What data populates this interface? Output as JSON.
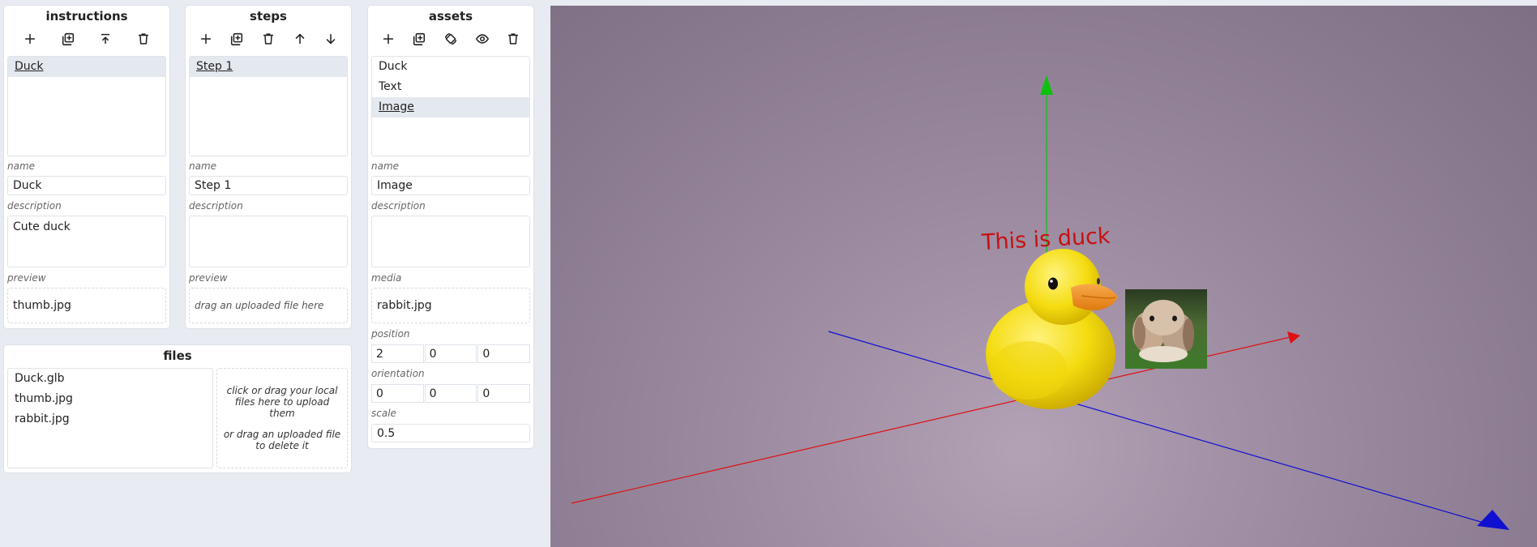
{
  "instructions": {
    "title": "instructions",
    "toolbar": [
      "add-icon",
      "duplicate-icon",
      "upload-icon",
      "delete-icon"
    ],
    "items": [
      {
        "label": "Duck",
        "selected": true
      }
    ],
    "name_label": "name",
    "name_value": "Duck",
    "description_label": "description",
    "description_value": "Cute duck",
    "preview_label": "preview",
    "preview_value": "thumb.jpg"
  },
  "steps": {
    "title": "steps",
    "toolbar": [
      "add-icon",
      "duplicate-icon",
      "delete-icon",
      "arrow-up-icon",
      "arrow-down-icon"
    ],
    "items": [
      {
        "label": "Step 1",
        "selected": true
      }
    ],
    "name_label": "name",
    "name_value": "Step 1",
    "description_label": "description",
    "description_value": "",
    "preview_label": "preview",
    "preview_placeholder": "drag an uploaded file here"
  },
  "assets": {
    "title": "assets",
    "toolbar": [
      "add-icon",
      "duplicate-icon",
      "rotate-icon",
      "eye-icon",
      "delete-icon"
    ],
    "items": [
      {
        "label": "Duck",
        "selected": false
      },
      {
        "label": "Text",
        "selected": false
      },
      {
        "label": "Image",
        "selected": true
      }
    ],
    "name_label": "name",
    "name_value": "Image",
    "description_label": "description",
    "description_value": "",
    "media_label": "media",
    "media_value": "rabbit.jpg",
    "position_label": "position",
    "position": [
      "2",
      "0",
      "0"
    ],
    "orientation_label": "orientation",
    "orientation": [
      "0",
      "0",
      "0"
    ],
    "scale_label": "scale",
    "scale_value": "0.5"
  },
  "files": {
    "title": "files",
    "items": [
      "Duck.glb",
      "thumb.jpg",
      "rabbit.jpg"
    ],
    "upload_hint": "click or drag your local files here to upload them",
    "delete_hint": "or drag an uploaded file to delete it"
  },
  "viewport": {
    "text_label": "This is duck",
    "colors": {
      "x_axis": "#e01010",
      "y_axis": "#10c010",
      "z_axis": "#1010d0",
      "duck_body": "#f4dc10",
      "duck_beak": "#f08c10",
      "text": "#c81010"
    }
  }
}
